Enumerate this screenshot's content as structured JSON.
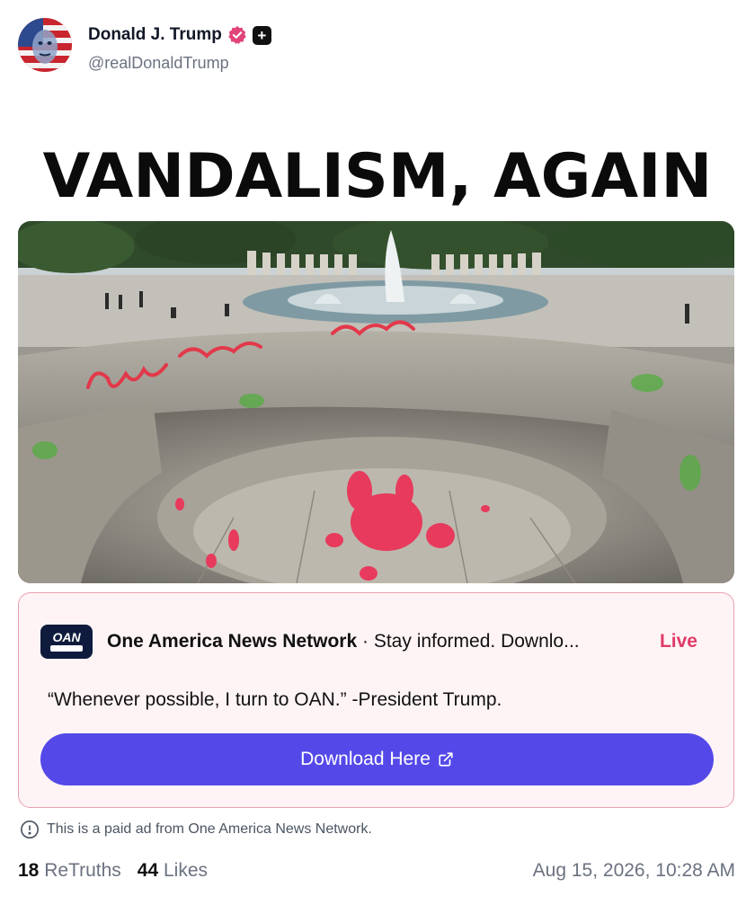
{
  "author": {
    "name": "Donald J. Trump",
    "handle": "@realDonaldTrump",
    "badge_plus": "+"
  },
  "media": {
    "headline": "VANDALISM, AGAIN"
  },
  "ad": {
    "logo_text": "OAN",
    "title": "One America News Network",
    "separator": " · ",
    "description": "Stay informed. Downlo...",
    "live_label": "Live",
    "quote": "“Whenever possible, I turn to OAN.” -President Trump.",
    "button_label": "Download Here"
  },
  "disclaimer": "This is a paid ad from One America News Network.",
  "stats": {
    "retruths_count": "18",
    "retruths_label": "ReTruths",
    "likes_count": "44",
    "likes_label": "Likes"
  },
  "timestamp": "Aug 15, 2026, 10:28 AM",
  "colors": {
    "accent_button": "#5449e8",
    "live_red": "#e03a68",
    "ad_border": "#e9a0ad",
    "verified_pink": "#e0447a"
  }
}
